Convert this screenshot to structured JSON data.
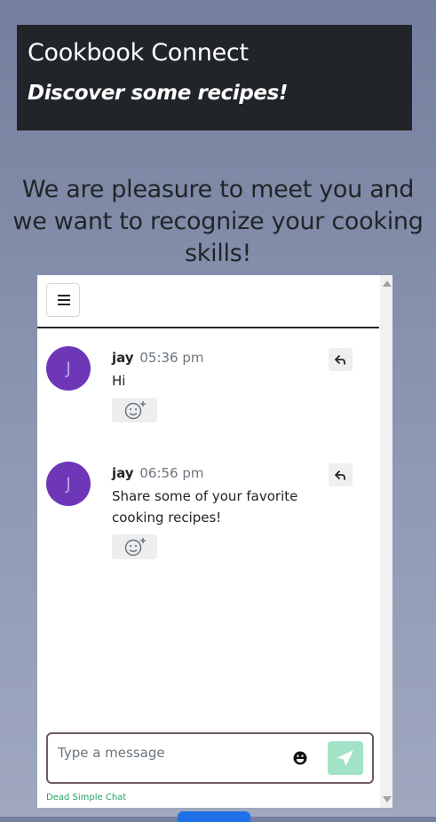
{
  "header": {
    "site_title": "Cookbook Connect",
    "tagline": "Discover some recipes!"
  },
  "headline": "We are pleasure to meet you and we want to recognize your cooking skills!",
  "chat": {
    "menu_icon": "hamburger-menu-icon",
    "messages": [
      {
        "avatar_initial": "J",
        "author": "jay",
        "time": "05:36 pm",
        "text": "Hi",
        "reply_icon": "reply-icon",
        "reaction_icon": "add-emoji-reaction-icon"
      },
      {
        "avatar_initial": "J",
        "author": "jay",
        "time": "06:56 pm",
        "text": "Share some of your favorite cooking recipes!",
        "reply_icon": "reply-icon",
        "reaction_icon": "add-emoji-reaction-icon"
      }
    ],
    "composer": {
      "placeholder": "Type a message",
      "value": "",
      "emoji_icon": "smiley-icon",
      "send_icon": "paper-plane-icon"
    },
    "powered_by": "Dead Simple Chat"
  },
  "colors": {
    "header_bg": "#212529",
    "avatar": "#6d37b8",
    "send_button": "#a2e3c7",
    "powered_by_link": "#20a463",
    "composer_border": "#6f5d60"
  }
}
